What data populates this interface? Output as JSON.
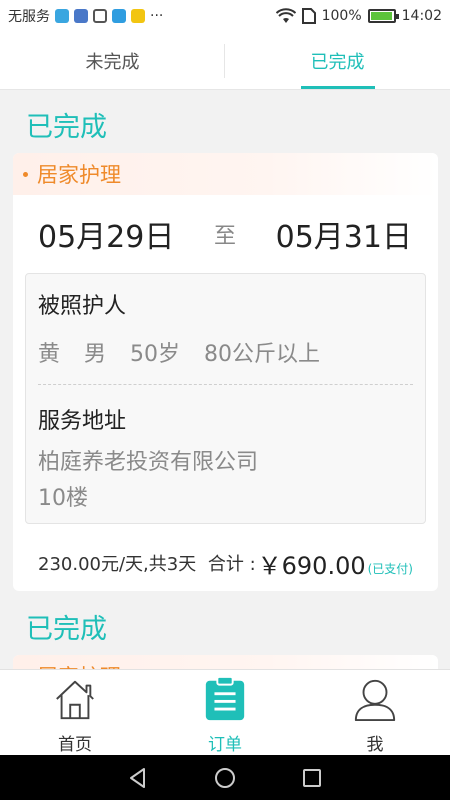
{
  "status_bar": {
    "carrier": "无服务",
    "more": "···",
    "battery_text": "100%",
    "battery_level": 1.0,
    "time": "14:02",
    "icons": [
      "location-icon",
      "app-icon",
      "gallery-icon",
      "shield-app-icon",
      "message-icon",
      "wifi-icon",
      "sim-icon",
      "battery-icon"
    ]
  },
  "tabs": [
    {
      "label": "未完成",
      "active": false
    },
    {
      "label": "已完成",
      "active": true
    }
  ],
  "orders": [
    {
      "status": "已完成",
      "service": "居家护理",
      "start_date": "05月29日",
      "to": "至",
      "end_date": "05月31日",
      "care_recipient_label": "被照护人",
      "recipient": {
        "name": "黄",
        "gender": "男",
        "age": "50岁",
        "weight": "80公斤以上"
      },
      "address_label": "服务地址",
      "address_line1": "柏庭养老投资有限公司",
      "address_line2": "10楼",
      "price_detail": "230.00元/天,共3天",
      "total_label": "合计 :",
      "total": "￥690.00",
      "paid_status": "(已支付)"
    },
    {
      "status": "已完成",
      "service": "居家护理"
    }
  ],
  "bottom_nav": [
    {
      "label": "首页",
      "icon": "home-icon",
      "active": false
    },
    {
      "label": "订单",
      "icon": "clipboard-icon",
      "active": true
    },
    {
      "label": "我",
      "icon": "person-icon",
      "active": false
    }
  ],
  "colors": {
    "accent": "#1fbfb8",
    "orange": "#ef8a2a"
  }
}
